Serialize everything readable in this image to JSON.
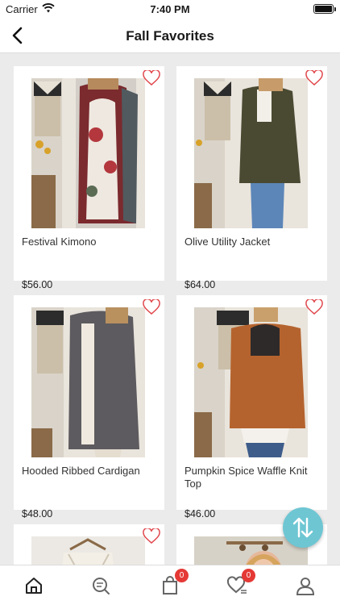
{
  "status": {
    "carrier": "Carrier",
    "time": "7:40 PM"
  },
  "header": {
    "title": "Fall Favorites"
  },
  "products": [
    {
      "name": "Festival Kimono",
      "price": "$56.00"
    },
    {
      "name": "Olive Utility Jacket",
      "price": "$64.00"
    },
    {
      "name": "Hooded Ribbed Cardigan",
      "price": "$48.00"
    },
    {
      "name": "Pumpkin Spice Waffle Knit Top",
      "price": "$46.00"
    },
    {
      "name": "",
      "price": ""
    },
    {
      "name": "",
      "price": ""
    }
  ],
  "tabbar": {
    "cart_count": "0",
    "wishlist_count": "0"
  },
  "colors": {
    "accent": "#6ec6d3",
    "badge": "#e53935",
    "heart": "#e0474c"
  }
}
